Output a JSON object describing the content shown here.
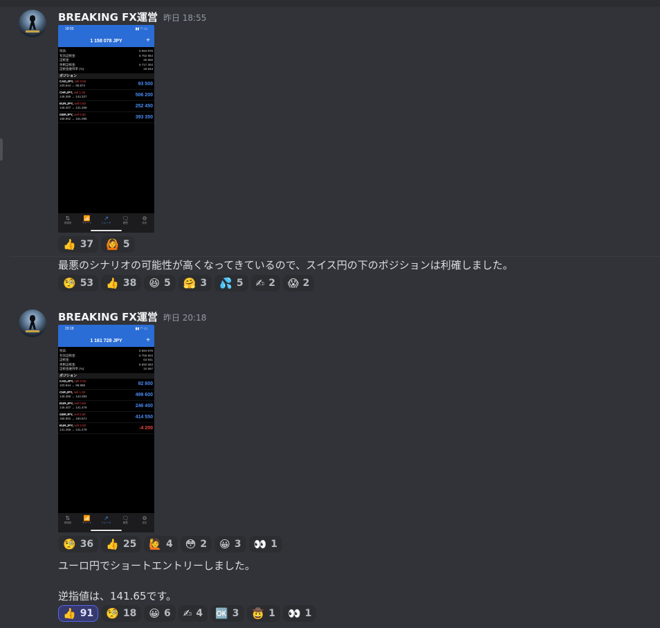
{
  "messages": [
    {
      "author": "BREAKING FX運営",
      "timestamp": "昨日 18:55",
      "screenshot": {
        "time": "18:55",
        "balance": "1 158 078 JPY",
        "plus": "+",
        "account": [
          {
            "label": "残高:",
            "value": "5 594 876"
          },
          {
            "label": "有効証拠金:",
            "value": "6 752 954"
          },
          {
            "label": "証拠金:",
            "value": "35 650"
          },
          {
            "label": "余剰証拠金:",
            "value": "6 717 304"
          },
          {
            "label": "証拠金維持率 (%):",
            "value": "18 943"
          }
        ],
        "section": "ポジション",
        "positions": [
          {
            "symbol": "CAD,JPY,",
            "side": "sell 0.50",
            "prices": "100.844 → 98.974",
            "profit": "93 500",
            "negative": false
          },
          {
            "symbol": "CHF,JPY,",
            "side": "sell 1.00",
            "prices": "148.389 → 143.327",
            "profit": "506 200",
            "negative": false
          },
          {
            "symbol": "EUR,JPY,",
            "side": "sell 0.50",
            "prices": "146.407 → 141.358",
            "profit": "252 450",
            "negative": false
          },
          {
            "symbol": "GBP,JPY,",
            "side": "sell 0.50",
            "prices": "168.962 → 161.095",
            "profit": "393 350",
            "negative": false
          }
        ],
        "tabs": [
          {
            "icon": "⇅",
            "label": "相場表",
            "active": false
          },
          {
            "icon": "📶",
            "label": "チャート",
            "active": false
          },
          {
            "icon": "↗",
            "label": "トレード",
            "active": true
          },
          {
            "icon": "🗨",
            "label": "履歴",
            "active": false
          },
          {
            "icon": "⚙",
            "label": "設定",
            "active": false
          }
        ]
      },
      "image_reactions": [
        {
          "emoji": "👍",
          "count": "37",
          "me": false
        },
        {
          "emoji": "🙆",
          "count": "5",
          "me": false
        }
      ],
      "text": "最悪のシナリオの可能性が高くなってきているので、スイス円の下のポジションは利確しました。",
      "text_reactions": [
        {
          "emoji": "🧐",
          "count": "53",
          "me": false
        },
        {
          "emoji": "👍",
          "count": "38",
          "me": false
        },
        {
          "emoji": "😆",
          "count": "5",
          "me": false
        },
        {
          "emoji": "🤗",
          "count": "3",
          "me": false
        },
        {
          "emoji": "💦",
          "count": "5",
          "me": false
        },
        {
          "emoji": "✍",
          "count": "2",
          "me": false
        },
        {
          "emoji": "😱",
          "count": "2",
          "me": false
        }
      ]
    },
    {
      "author": "BREAKING FX運営",
      "timestamp": "昨日 20:18",
      "screenshot": {
        "time": "20:18",
        "balance": "1 161 728 JPY",
        "plus": "+",
        "account": [
          {
            "label": "残高:",
            "value": "5 594 876"
          },
          {
            "label": "有効証拠金:",
            "value": "6 756 604"
          },
          {
            "label": "証拠金:",
            "value": "63 941"
          },
          {
            "label": "余剰証拠金:",
            "value": "6 692 663"
          },
          {
            "label": "証拠金維持率 (%):",
            "value": "10 567"
          }
        ],
        "section": "ポジション",
        "positions": [
          {
            "symbol": "CAD,JPY,",
            "side": "sell 0.50",
            "prices": "100.844 → 98.988",
            "profit": "92 800",
            "negative": false
          },
          {
            "symbol": "CHF,JPY,",
            "side": "sell 1.00",
            "prices": "148.389 → 143.393",
            "profit": "499 600",
            "negative": false
          },
          {
            "symbol": "EUR,JPY,",
            "side": "sell 0.50",
            "prices": "146.407 → 141.479",
            "profit": "246 400",
            "negative": false
          },
          {
            "symbol": "GBP,JPY,",
            "side": "sell 0.50",
            "prices": "168.962 → 160.671",
            "profit": "414 550",
            "negative": false
          },
          {
            "symbol": "EUR,JPY,",
            "side": "sell 2.00",
            "prices": "141.458 → 141.479",
            "profit": "-4 200",
            "negative": true
          }
        ],
        "tabs": [
          {
            "icon": "⇅",
            "label": "相場表",
            "active": false
          },
          {
            "icon": "📶",
            "label": "チャート",
            "active": false
          },
          {
            "icon": "↗",
            "label": "トレード",
            "active": true
          },
          {
            "icon": "🗨",
            "label": "履歴",
            "active": false
          },
          {
            "icon": "⚙",
            "label": "設定",
            "active": false
          }
        ]
      },
      "image_reactions": [
        {
          "emoji": "🧐",
          "count": "36",
          "me": false
        },
        {
          "emoji": "👍",
          "count": "25",
          "me": false
        },
        {
          "emoji": "🙋",
          "count": "4",
          "me": false
        },
        {
          "emoji": "😳",
          "count": "2",
          "me": false
        },
        {
          "emoji": "😀",
          "count": "3",
          "me": false
        },
        {
          "emoji": "👀",
          "count": "1",
          "me": false
        }
      ],
      "text_line1": "ユーロ円でショートエントリーしました。",
      "text_line2": "逆指値は、141.65です。",
      "text_reactions": [
        {
          "emoji": "👍",
          "count": "91",
          "me": true
        },
        {
          "emoji": "🧐",
          "count": "18",
          "me": false
        },
        {
          "emoji": "😀",
          "count": "6",
          "me": false
        },
        {
          "emoji": "✍",
          "count": "4",
          "me": false
        },
        {
          "emoji": "🆗",
          "count": "3",
          "me": false
        },
        {
          "emoji": "🤠",
          "count": "1",
          "me": false
        },
        {
          "emoji": "👀",
          "count": "1",
          "me": false
        }
      ]
    }
  ]
}
